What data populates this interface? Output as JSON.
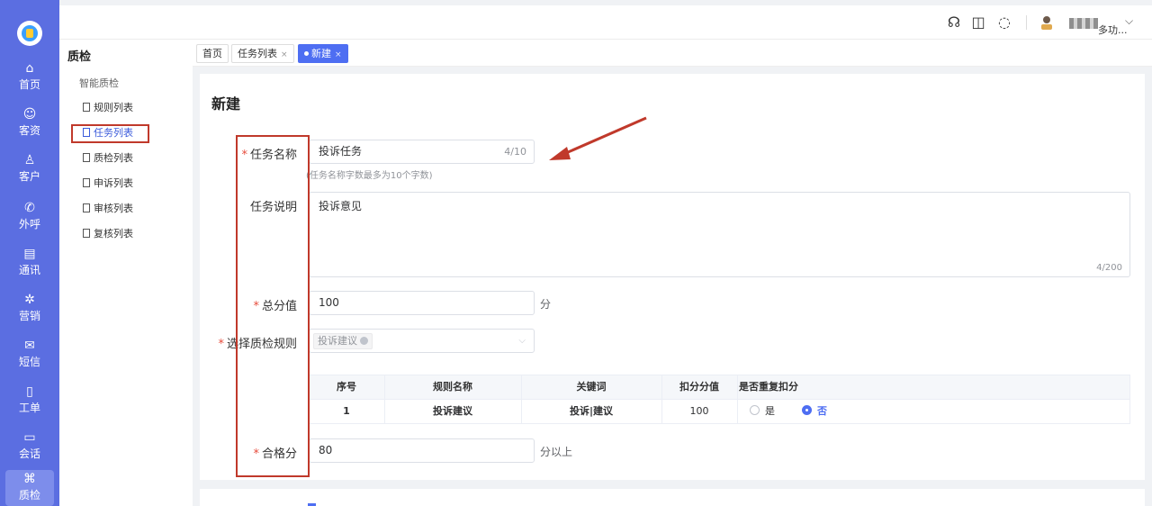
{
  "rail": {
    "items": [
      {
        "label": "首页",
        "icon": "home-icon"
      },
      {
        "label": "客资",
        "icon": "users-icon"
      },
      {
        "label": "客户",
        "icon": "user-icon"
      },
      {
        "label": "外呼",
        "icon": "phone-icon"
      },
      {
        "label": "通讯",
        "icon": "contacts-icon"
      },
      {
        "label": "营销",
        "icon": "marketing-icon"
      },
      {
        "label": "短信",
        "icon": "sms-icon"
      },
      {
        "label": "工单",
        "icon": "clipboard-icon"
      },
      {
        "label": "会话",
        "icon": "chat-icon"
      },
      {
        "label": "质检",
        "icon": "inspect-icon"
      }
    ],
    "active_index": 9
  },
  "header": {
    "icons": [
      "headset-icon",
      "book-icon",
      "message-icon"
    ],
    "user_line2": "多功..."
  },
  "subnav": {
    "title": "质检",
    "group": "智能质检",
    "items": [
      "规则列表",
      "任务列表",
      "质检列表",
      "申诉列表",
      "审核列表",
      "复核列表"
    ],
    "active_index": 1
  },
  "tabs": [
    {
      "label": "首页",
      "closable": false
    },
    {
      "label": "任务列表",
      "closable": true
    },
    {
      "label": "新建",
      "closable": true,
      "active": true
    }
  ],
  "form": {
    "title": "新建",
    "task_name": {
      "label": "任务名称",
      "value": "投诉任务",
      "counter": "4/10",
      "hint": "(任务名称字数最多为10个字数)"
    },
    "task_desc": {
      "label": "任务说明",
      "value": "投诉意见",
      "counter": "4/200"
    },
    "total_score": {
      "label": "总分值",
      "value": "100",
      "unit": "分"
    },
    "rule_select": {
      "label": "选择质检规则",
      "tag": "投诉建议"
    },
    "pass_score": {
      "label": "合格分",
      "value": "80",
      "unit": "分以上"
    }
  },
  "rule_table": {
    "headers": [
      "序号",
      "规则名称",
      "关键词",
      "扣分分值",
      "是否重复扣分"
    ],
    "rows": [
      {
        "index": "1",
        "name": "投诉建议",
        "keywords": "投诉|建议",
        "deduct": "100",
        "opt_yes": "是",
        "opt_no": "否",
        "selected": "否"
      }
    ]
  },
  "colors": {
    "rail": "#5b6ee1",
    "accent": "#4e6ef2",
    "annotation": "#c0392b"
  }
}
